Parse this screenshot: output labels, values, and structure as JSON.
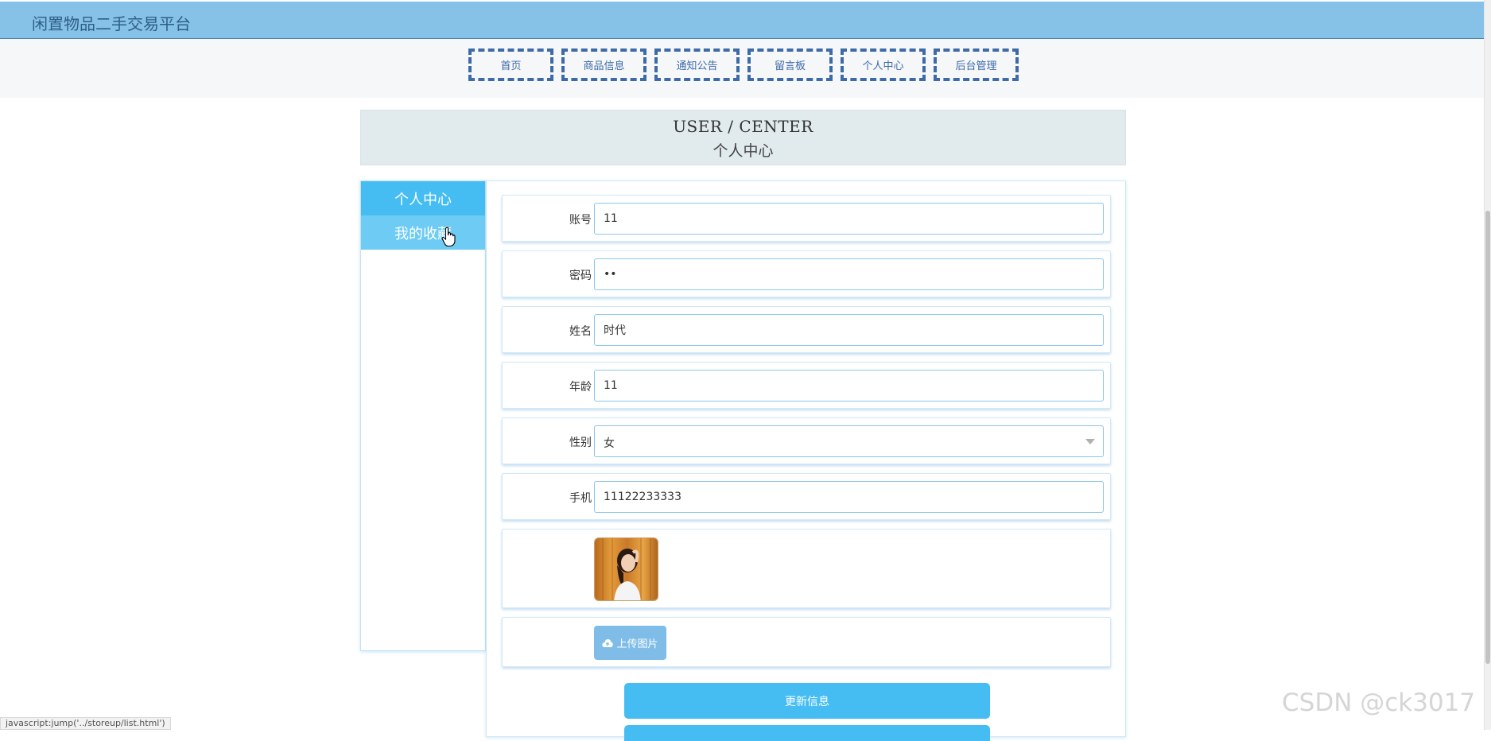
{
  "header": {
    "site_title": "闲置物品二手交易平台"
  },
  "nav": {
    "items": [
      "首页",
      "商品信息",
      "通知公告",
      "留言板",
      "个人中心",
      "后台管理"
    ]
  },
  "center_header": {
    "en": "USER / CENTER",
    "cn": "个人中心"
  },
  "side_menu": {
    "items": [
      "个人中心",
      "我的收藏"
    ]
  },
  "form": {
    "account": {
      "label": "账号",
      "value": "11"
    },
    "password": {
      "label": "密码",
      "value": "11"
    },
    "name": {
      "label": "姓名",
      "value": "时代"
    },
    "age": {
      "label": "年龄",
      "value": "11"
    },
    "gender": {
      "label": "性别",
      "value": "女"
    },
    "phone": {
      "label": "手机",
      "value": "11122233333"
    },
    "upload_label": "上传图片",
    "update_label": "更新信息"
  },
  "status_bar": "javascript:jump('../storeup/list.html')",
  "watermark": "CSDN @ck3017",
  "colors": {
    "topbar": "#86c1e8",
    "accent": "#45bdf2",
    "nav_border": "#3d6aa8"
  }
}
